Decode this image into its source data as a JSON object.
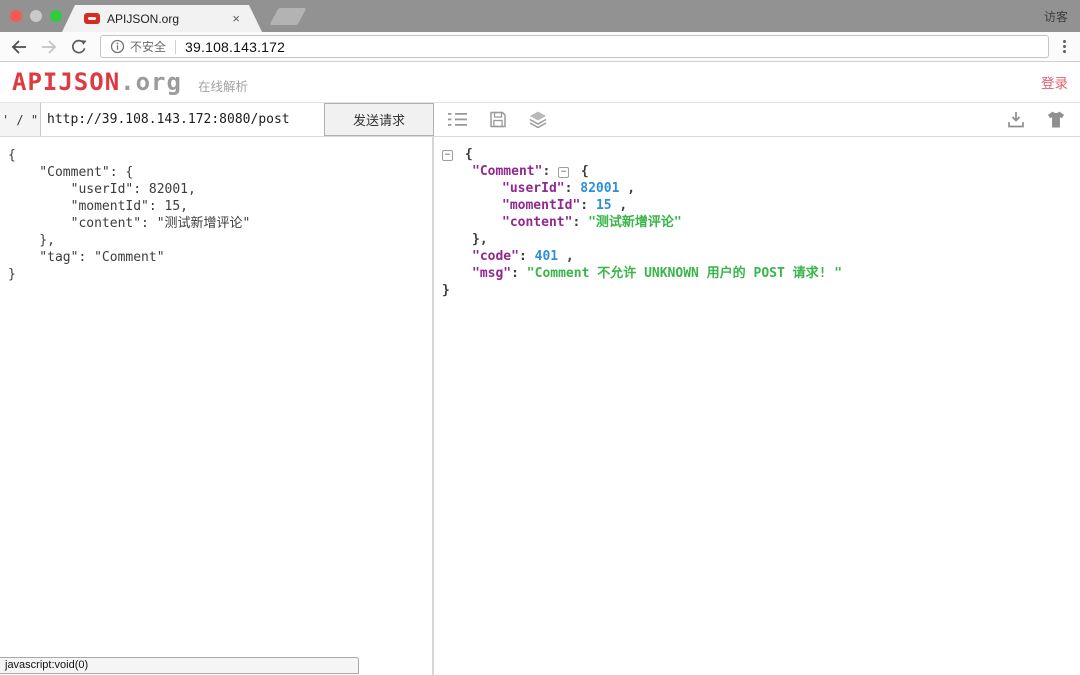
{
  "browser": {
    "tab_title": "APIJSON.org",
    "tab_close": "×",
    "profile_label": "访客",
    "security_label": "不安全",
    "url": "39.108.143.172"
  },
  "header": {
    "logo_primary": "APIJSON",
    "logo_suffix": ".org",
    "subtitle": "在线解析",
    "login_label": "登录"
  },
  "request_bar": {
    "quote_toggle_label": "' / \"",
    "url_value": "http://39.108.143.172:8080/post",
    "send_label": "发送请求"
  },
  "request_editor": {
    "content": "{\n    \"Comment\": {\n        \"userId\": 82001,\n        \"momentId\": 15,\n        \"content\": \"测试新增评论\"\n    },\n    \"tag\": \"Comment\"\n}"
  },
  "response_viewer": {
    "lines": [
      {
        "indent": 0,
        "segments": [
          {
            "cls": "toggle",
            "text": "−"
          },
          {
            "cls": "plain",
            "text": " {"
          }
        ]
      },
      {
        "indent": 1,
        "segments": [
          {
            "cls": "key",
            "text": "\"Comment\""
          },
          {
            "cls": "plain",
            "text": ": "
          },
          {
            "cls": "toggle",
            "text": "−"
          },
          {
            "cls": "plain",
            "text": " {"
          }
        ]
      },
      {
        "indent": 2,
        "segments": [
          {
            "cls": "key",
            "text": "\"userId\""
          },
          {
            "cls": "plain",
            "text": ": "
          },
          {
            "cls": "num",
            "text": "82001"
          },
          {
            "cls": "plain",
            "text": " ,"
          }
        ]
      },
      {
        "indent": 2,
        "segments": [
          {
            "cls": "key",
            "text": "\"momentId\""
          },
          {
            "cls": "plain",
            "text": ": "
          },
          {
            "cls": "num",
            "text": "15"
          },
          {
            "cls": "plain",
            "text": " ,"
          }
        ]
      },
      {
        "indent": 2,
        "segments": [
          {
            "cls": "key",
            "text": "\"content\""
          },
          {
            "cls": "plain",
            "text": ": "
          },
          {
            "cls": "str",
            "text": "\"测试新增评论\""
          }
        ]
      },
      {
        "indent": 1,
        "segments": [
          {
            "cls": "plain",
            "text": "},"
          }
        ]
      },
      {
        "indent": 1,
        "segments": [
          {
            "cls": "key",
            "text": "\"code\""
          },
          {
            "cls": "plain",
            "text": ": "
          },
          {
            "cls": "num",
            "text": "401"
          },
          {
            "cls": "plain",
            "text": " ,"
          }
        ]
      },
      {
        "indent": 1,
        "segments": [
          {
            "cls": "key",
            "text": "\"msg\""
          },
          {
            "cls": "plain",
            "text": ": "
          },
          {
            "cls": "str",
            "text": "\"Comment 不允许 UNKNOWN 用户的 POST 请求! \""
          }
        ]
      },
      {
        "indent": 0,
        "segments": [
          {
            "cls": "plain",
            "text": "}"
          }
        ]
      }
    ]
  },
  "status_bar": {
    "text": "javascript:void(0)"
  },
  "colors": {
    "brand_red": "#dd3b41",
    "login_pink": "#e4606c",
    "json_key": "#92278f",
    "json_number": "#2e8fd8",
    "json_string": "#3ab54a"
  }
}
